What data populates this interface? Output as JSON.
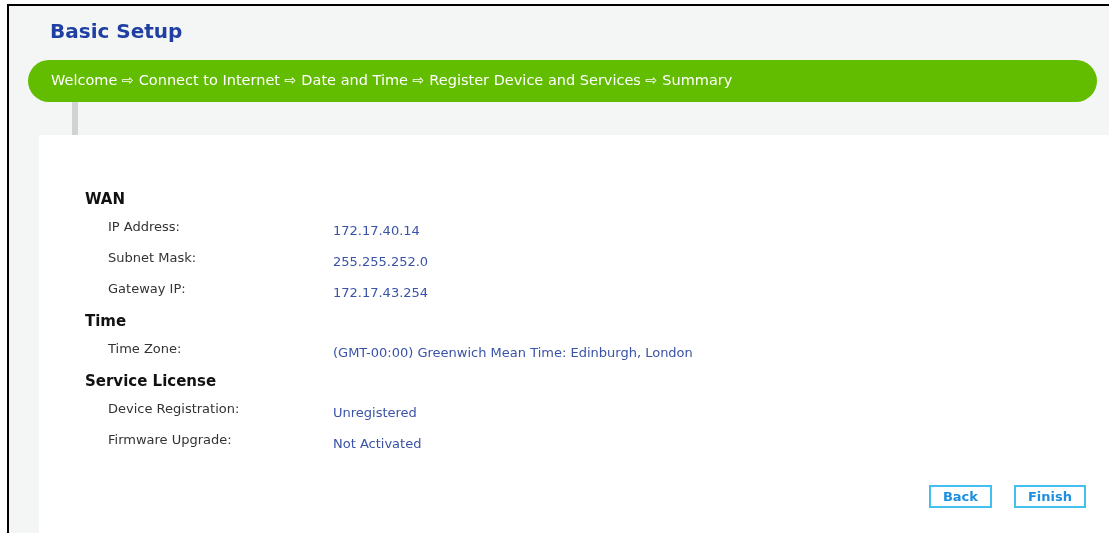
{
  "page": {
    "title": "Basic Setup"
  },
  "steps": "Welcome ⇨ Connect to Internet ⇨ Date and Time ⇨ Register Device and Services ⇨ Summary",
  "sections": [
    {
      "heading": "WAN",
      "rows": [
        {
          "label": "IP Address:",
          "value": "172.17.40.14"
        },
        {
          "label": "Subnet Mask:",
          "value": "255.255.252.0"
        },
        {
          "label": "Gateway IP:",
          "value": "172.17.43.254"
        }
      ]
    },
    {
      "heading": "Time",
      "rows": [
        {
          "label": "Time Zone:",
          "value": "(GMT-00:00) Greenwich Mean Time: Edinburgh, London"
        }
      ]
    },
    {
      "heading": "Service License",
      "rows": [
        {
          "label": "Device Registration:",
          "value": "Unregistered"
        },
        {
          "label": "Firmware Upgrade:",
          "value": "Not Activated"
        }
      ]
    }
  ],
  "buttons": [
    "Back",
    "Finish"
  ]
}
